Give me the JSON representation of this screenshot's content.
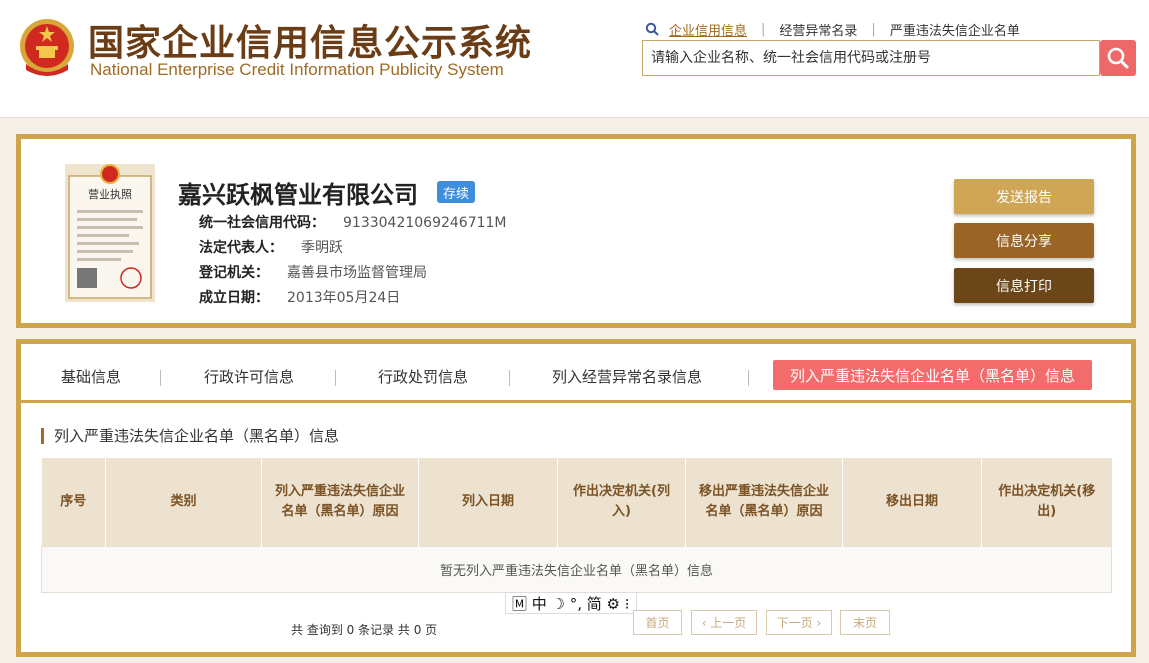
{
  "header": {
    "title_cn": "国家企业信用信息公示系统",
    "title_en": "National Enterprise Credit Information Publicity System",
    "nav": [
      {
        "label": "企业信用信息"
      },
      {
        "label": "经营异常名录"
      },
      {
        "label": "严重违法失信企业名单"
      }
    ],
    "search_placeholder": "请输入企业名称、统一社会信用代码或注册号"
  },
  "company": {
    "name": "嘉兴跃枫管业有限公司",
    "status": "存续",
    "credit_code_label": "统一社会信用代码：",
    "credit_code": "91330421069246711M",
    "legal_rep_label": "法定代表人：",
    "legal_rep": "季明跃",
    "authority_label": "登记机关：",
    "authority": "嘉善县市场监督管理局",
    "est_date_label": "成立日期：",
    "est_date": "2013年05月24日",
    "license_label": "营业执照"
  },
  "actions": {
    "report": "发送报告",
    "share": "信息分享",
    "print": "信息打印"
  },
  "tabs": [
    {
      "label": "基础信息"
    },
    {
      "label": "行政许可信息"
    },
    {
      "label": "行政处罚信息"
    },
    {
      "label": "列入经营异常名录信息"
    },
    {
      "label": "列入严重违法失信企业名单（黑名单）信息"
    }
  ],
  "section": {
    "title": "列入严重违法失信企业名单（黑名单）信息",
    "columns": [
      "序号",
      "类别",
      "列入严重违法失信企业名单（黑名单）原因",
      "列入日期",
      "作出决定机关(列入)",
      "移出严重违法失信企业名单（黑名单）原因",
      "移出日期",
      "作出决定机关(移出)"
    ],
    "empty_text": "暂无列入严重违法失信企业名单（黑名单）信息"
  },
  "ime": {
    "text": "🄼 中 ☽ °, 简 ⚙ ⁝"
  },
  "pager": {
    "summary": "共 查询到 0 条记录 共 0 页",
    "first": "首页",
    "prev": "‹ 上一页",
    "next": "下一页 ›",
    "last": "末页"
  },
  "colors": {
    "brand_brown": "#6b3d16",
    "gold_border": "#cfa54b",
    "active_tab": "#f26c6c",
    "status_badge": "#3f8ede",
    "search_button": "#ef6868"
  }
}
